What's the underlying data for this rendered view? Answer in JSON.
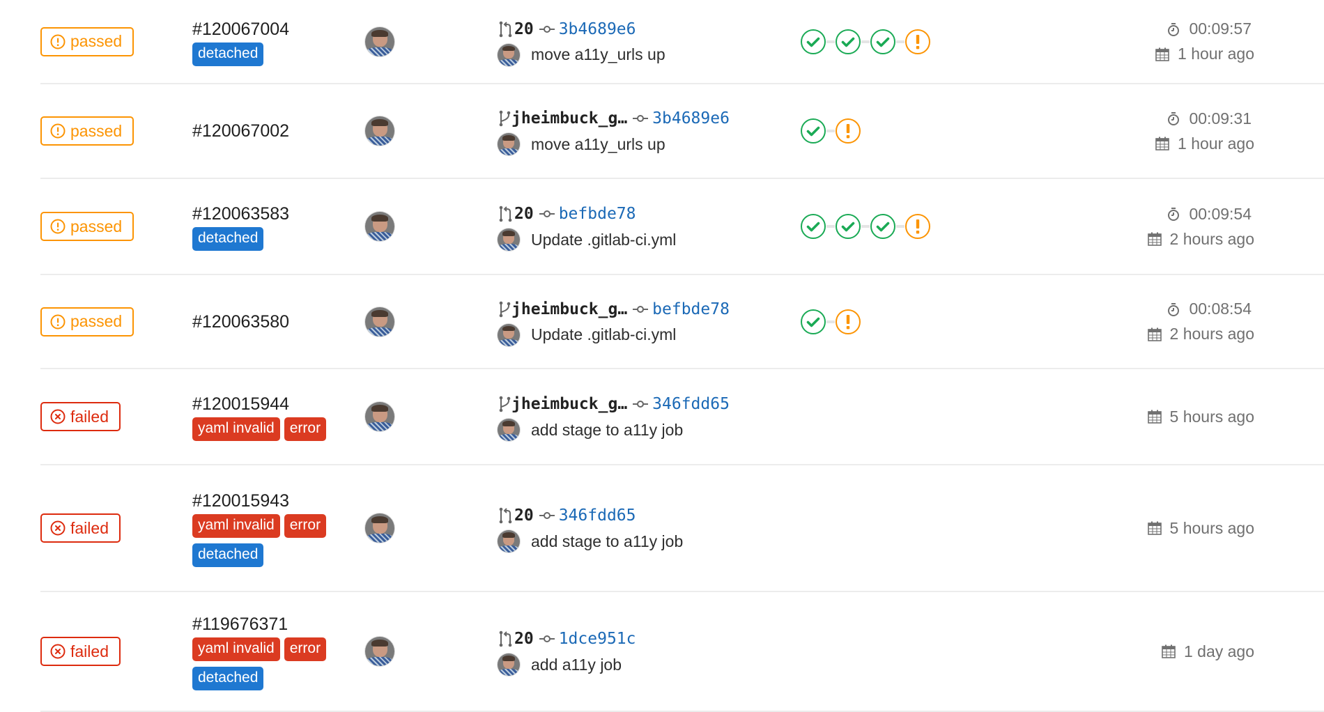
{
  "colors": {
    "passed_warning": "#fc9403",
    "failed": "#dd2b0e",
    "badge_detached": "#1f78d1",
    "badge_error": "#db3b21",
    "link": "#1b69b6",
    "success": "#1aaa55",
    "muted": "#707070"
  },
  "pipelines": [
    {
      "status": "passed",
      "status_icon": "warning-icon",
      "id": "#120067004",
      "badges": [
        [
          "detached"
        ]
      ],
      "ref_type": "merge-request",
      "ref": "20",
      "sha": "3b4689e6",
      "message": "move a11y_urls up",
      "stages": [
        "success",
        "success",
        "success",
        "warning"
      ],
      "duration": "00:09:57",
      "finished": "1 hour ago"
    },
    {
      "status": "passed",
      "status_icon": "warning-icon",
      "id": "#120067002",
      "badges": [],
      "ref_type": "branch",
      "ref": "jheimbuck_g…",
      "sha": "3b4689e6",
      "message": "move a11y_urls up",
      "stages": [
        "success",
        "warning"
      ],
      "duration": "00:09:31",
      "finished": "1 hour ago"
    },
    {
      "status": "passed",
      "status_icon": "warning-icon",
      "id": "#120063583",
      "badges": [
        [
          "detached"
        ]
      ],
      "ref_type": "merge-request",
      "ref": "20",
      "sha": "befbde78",
      "message": "Update .gitlab-ci.yml",
      "stages": [
        "success",
        "success",
        "success",
        "warning"
      ],
      "duration": "00:09:54",
      "finished": "2 hours ago"
    },
    {
      "status": "passed",
      "status_icon": "warning-icon",
      "id": "#120063580",
      "badges": [],
      "ref_type": "branch",
      "ref": "jheimbuck_g…",
      "sha": "befbde78",
      "message": "Update .gitlab-ci.yml",
      "stages": [
        "success",
        "warning"
      ],
      "duration": "00:08:54",
      "finished": "2 hours ago"
    },
    {
      "status": "failed",
      "status_icon": "error-icon",
      "id": "#120015944",
      "badges": [
        [
          "yaml invalid",
          "error"
        ]
      ],
      "ref_type": "branch",
      "ref": "jheimbuck_g…",
      "sha": "346fdd65",
      "message": "add stage to a11y job",
      "stages": [],
      "duration": null,
      "finished": "5 hours ago"
    },
    {
      "status": "failed",
      "status_icon": "error-icon",
      "id": "#120015943",
      "badges": [
        [
          "yaml invalid",
          "error"
        ],
        [
          "detached"
        ]
      ],
      "ref_type": "merge-request",
      "ref": "20",
      "sha": "346fdd65",
      "message": "add stage to a11y job",
      "stages": [],
      "duration": null,
      "finished": "5 hours ago"
    },
    {
      "status": "failed",
      "status_icon": "error-icon",
      "id": "#119676371",
      "badges": [
        [
          "yaml invalid",
          "error"
        ],
        [
          "detached"
        ]
      ],
      "ref_type": "merge-request",
      "ref": "20",
      "sha": "1dce951c",
      "message": "add a11y job",
      "stages": [],
      "duration": null,
      "finished": "1 day ago"
    }
  ]
}
